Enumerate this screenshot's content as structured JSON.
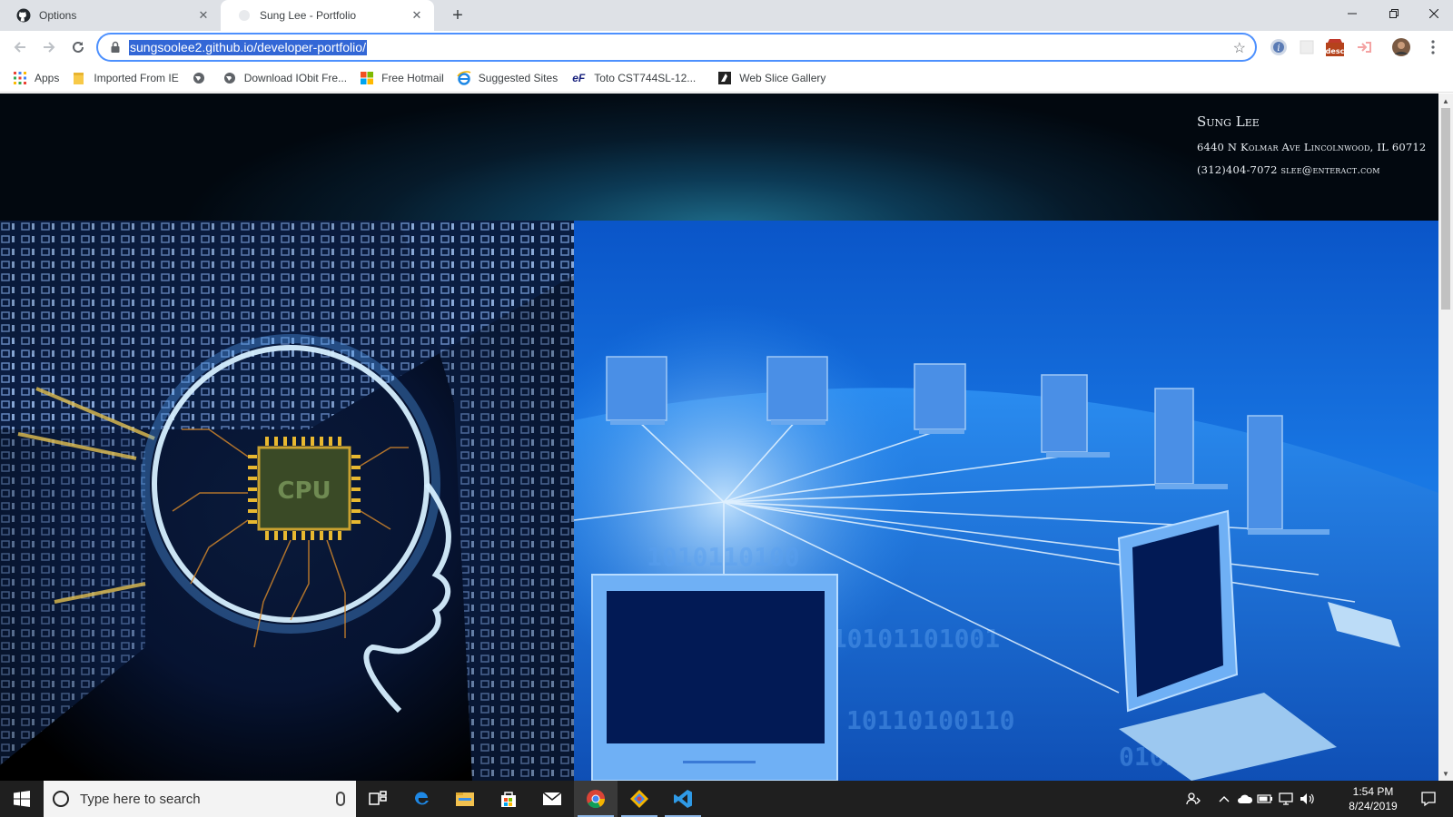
{
  "browser": {
    "tabs": [
      {
        "title": "Options",
        "icon": "github-icon",
        "active": false
      },
      {
        "title": "Sung Lee - Portfolio",
        "icon": "page-icon",
        "active": true
      }
    ],
    "url": "sungsoolee2.github.io/developer-portfolio/",
    "bookmarks": [
      {
        "label": "Apps",
        "icon": "apps-grid-icon"
      },
      {
        "label": "Imported From IE",
        "icon": "folder-icon"
      },
      {
        "label": "",
        "icon": "globe-icon"
      },
      {
        "label": "Download IObit Fre...",
        "icon": "globe-icon"
      },
      {
        "label": "Free Hotmail",
        "icon": "windows-logo-icon"
      },
      {
        "label": "Suggested Sites",
        "icon": "ie-icon"
      },
      {
        "label": "Toto CST744SL-12...",
        "icon": "ef-icon"
      },
      {
        "label": "Web Slice Gallery",
        "icon": "web-slice-icon"
      }
    ],
    "extensions": {
      "desc_label": "desc"
    }
  },
  "page": {
    "contact": {
      "name": "Sung Lee",
      "address": "6440 N Kolmar Ave Lincolnwood, IL 60712",
      "phone_email": "(312)404-7072 slee@enteract.com"
    },
    "left_image": {
      "label": "CPU"
    }
  },
  "taskbar": {
    "search_placeholder": "Type here to search",
    "time": "1:54 PM",
    "date": "8/24/2019"
  }
}
